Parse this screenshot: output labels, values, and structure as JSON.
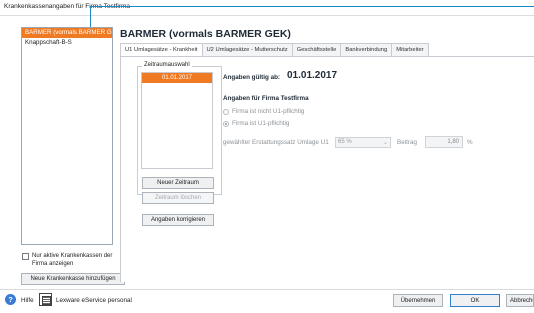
{
  "window": {
    "title": "Krankenkassenangaben für Firma Testfirma"
  },
  "sidebar": {
    "items": [
      {
        "label": "BARMER (vormals BARMER GEK)"
      },
      {
        "label": "Knappschaft-B-S"
      }
    ],
    "only_active_label": "Nur aktive Krankenkassen der Firma anzeigen",
    "add_button_label": "Neue Krankenkasse hinzufügen"
  },
  "main": {
    "title": "BARMER (vormals BARMER GEK)",
    "tabs": [
      {
        "label": "U1 Umlagesätze - Krankheit"
      },
      {
        "label": "U2 Umlagesätze - Mutterschutz"
      },
      {
        "label": "Geschäftsstelle"
      },
      {
        "label": "Bankverbindung"
      },
      {
        "label": "Mitarbeiter"
      }
    ],
    "zeitraum": {
      "legend": "Zeitraumauswahl",
      "selected_date": "01.01.2017",
      "new_button": "Neuer Zeitraum",
      "delete_button": "Zeitraum löschen"
    },
    "correct_button": "Angaben korrigieren",
    "valid_from_label": "Angaben gültig ab:",
    "valid_from_value": "01.01.2017",
    "firm_section_title": "Angaben für Firma Testfirma",
    "radio_not_obliged": "Firma ist nicht U1-pflichtig",
    "radio_obliged": "Firma ist U1-pflichtig",
    "rate_label": "gewählter Erstattungssatz Umlage U1",
    "rate_value": "65 %",
    "beitrag_label": "Beitrag",
    "beitrag_value": "1,80",
    "beitrag_unit": "%"
  },
  "footer": {
    "help_label": "Hilfe",
    "eservice_label": "Lexware eService personal",
    "apply_button": "Übernehmen",
    "ok_button": "OK",
    "cancel_button": "Abbreche"
  },
  "colors": {
    "accent": "#f07a22",
    "callout": "#1b87c9"
  }
}
